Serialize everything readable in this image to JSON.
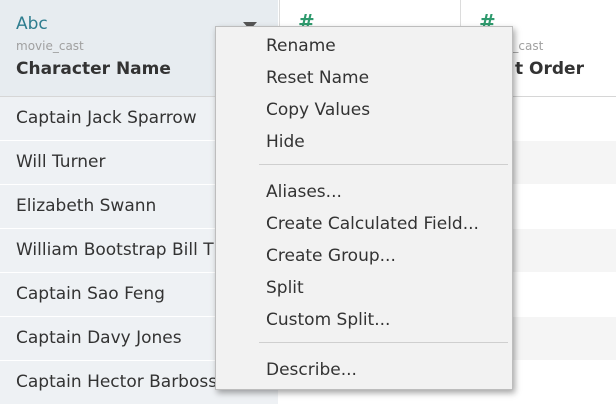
{
  "columns": [
    {
      "type_label": "Abc",
      "source": "movie_cast",
      "name": "Character Name"
    },
    {
      "type_icon": "#"
    },
    {
      "type_icon": "#",
      "source_partial": "e_cast",
      "name_partial": "t Order"
    }
  ],
  "rows": [
    "Captain Jack Sparrow",
    "Will Turner",
    "Elizabeth Swann",
    "William Bootstrap Bill T",
    "Captain Sao Feng",
    "Captain Davy Jones",
    "Captain Hector Barboss"
  ],
  "menu": {
    "group1": [
      "Rename",
      "Reset Name",
      "Copy Values",
      "Hide"
    ],
    "group2": [
      "Aliases...",
      "Create Calculated Field...",
      "Create Group...",
      "Split",
      "Custom Split..."
    ],
    "group3": [
      "Describe..."
    ]
  },
  "colors": {
    "string_type": "#2e7d8f",
    "number_type": "#2f9a6e"
  }
}
